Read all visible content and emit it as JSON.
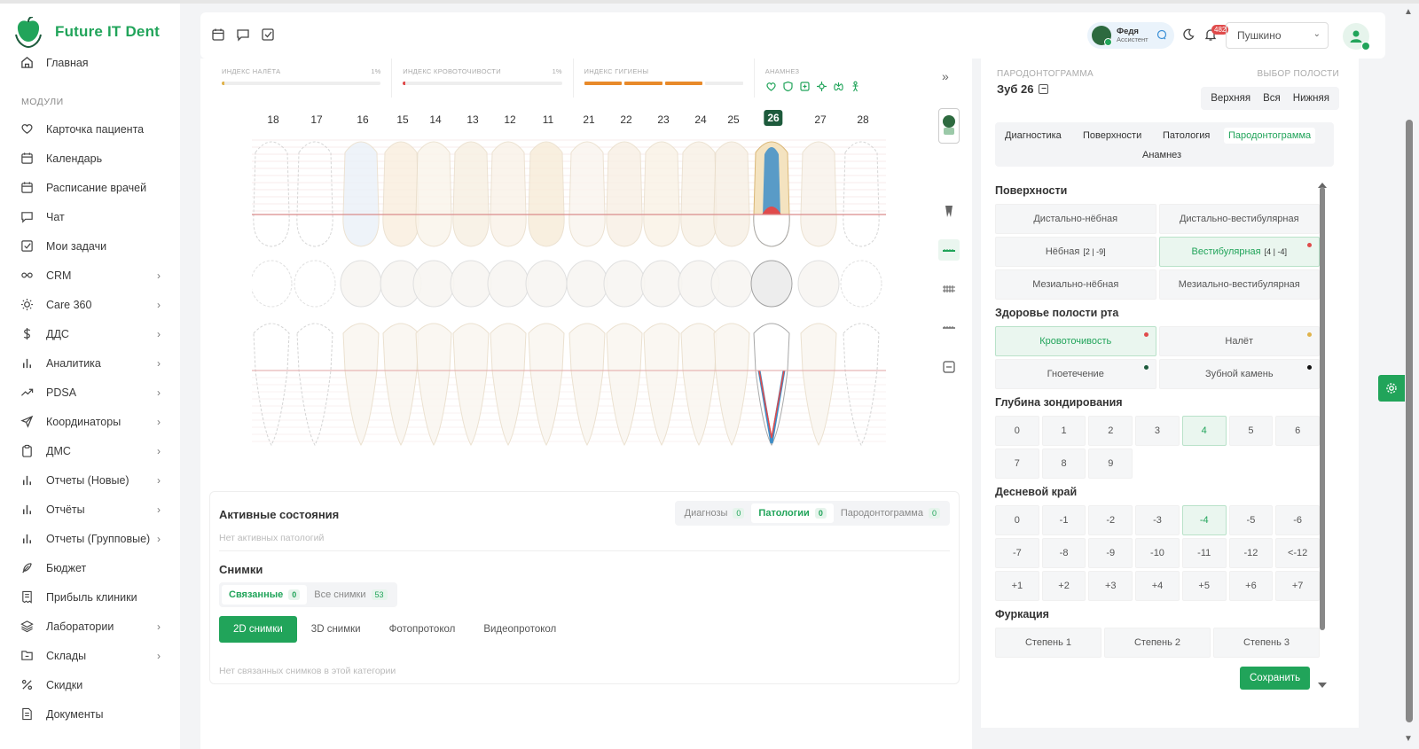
{
  "app": {
    "name": "Future IT Dent"
  },
  "sidebar": {
    "home": "Главная",
    "section_label": "МОДУЛИ",
    "items": [
      {
        "label": "Карточка пациента",
        "icon": "heart-icon",
        "chev": false
      },
      {
        "label": "Календарь",
        "icon": "calendar-icon",
        "chev": false
      },
      {
        "label": "Расписание врачей",
        "icon": "calendar-icon",
        "chev": false
      },
      {
        "label": "Чат",
        "icon": "chat-icon",
        "chev": false
      },
      {
        "label": "Мои задачи",
        "icon": "checkbox-icon",
        "chev": false
      },
      {
        "label": "CRM",
        "icon": "crm-icon",
        "chev": true
      },
      {
        "label": "Care 360",
        "icon": "sun-icon",
        "chev": true
      },
      {
        "label": "ДДС",
        "icon": "dollar-icon",
        "chev": true
      },
      {
        "label": "Аналитика",
        "icon": "bar-chart-icon",
        "chev": true
      },
      {
        "label": "PDSA",
        "icon": "trend-icon",
        "chev": true
      },
      {
        "label": "Координаторы",
        "icon": "send-icon",
        "chev": true
      },
      {
        "label": "ДМС",
        "icon": "clipboard-icon",
        "chev": true
      },
      {
        "label": "Отчеты (Новые)",
        "icon": "bar-chart-icon",
        "chev": true
      },
      {
        "label": "Отчёты",
        "icon": "bar-chart-icon",
        "chev": true
      },
      {
        "label": "Отчеты (Групповые)",
        "icon": "bar-chart-icon",
        "chev": true
      },
      {
        "label": "Бюджет",
        "icon": "feather-icon",
        "chev": false
      },
      {
        "label": "Прибыль клиники",
        "icon": "receipt-icon",
        "chev": false
      },
      {
        "label": "Лаборатории",
        "icon": "layers-icon",
        "chev": true
      },
      {
        "label": "Склады",
        "icon": "folder-icon",
        "chev": true
      },
      {
        "label": "Скидки",
        "icon": "percent-icon",
        "chev": false
      },
      {
        "label": "Документы",
        "icon": "document-icon",
        "chev": false
      }
    ]
  },
  "header": {
    "user_name": "Федя",
    "user_role": "Ассистент",
    "notifications": "482",
    "branch": "Пушкино"
  },
  "indices": [
    {
      "label": "ИНДЕКС НАЛЁТА",
      "pct": "1%",
      "value": 0.01
    },
    {
      "label": "ИНДЕКС КРОВОТОЧИВОСТИ",
      "pct": "1%",
      "value": 0.01
    },
    {
      "label": "ИНДЕКС ГИГИЕНЫ",
      "pct": "",
      "value": 0.75
    },
    {
      "label": "АНАМНЕЗ",
      "pct": "",
      "value": 0
    }
  ],
  "teeth_upper": [
    "18",
    "17",
    "16",
    "15",
    "14",
    "13",
    "12",
    "11",
    "21",
    "22",
    "23",
    "24",
    "25",
    "26",
    "27",
    "28"
  ],
  "selected_tooth": "26",
  "states": {
    "title": "Активные состояния",
    "tabs": [
      {
        "label": "Диагнозы",
        "count": "0"
      },
      {
        "label": "Патологии",
        "count": "0"
      },
      {
        "label": "Пародонтограмма",
        "count": "0"
      }
    ],
    "empty": "Нет активных патологий",
    "shots_title": "Снимки",
    "shots_tabs": [
      {
        "label": "Связанные",
        "count": "0"
      },
      {
        "label": "Все снимки",
        "count": "53"
      }
    ],
    "shot_types": [
      "2D снимки",
      "3D снимки",
      "Фотопротокол",
      "Видеопротокол"
    ],
    "shots_empty": "Нет связанных снимков в этой категории"
  },
  "right": {
    "perio_label": "ПАРОДОНТОГРАММА",
    "polos_label": "ВЫБОР ПОЛОСТИ",
    "tooth_title": "Зуб 26",
    "jaw_tabs": [
      "Верхняя",
      "Вся",
      "Нижняя"
    ],
    "main_tabs": [
      "Диагностика",
      "Поверхности",
      "Патология",
      "Пародонтограмма",
      "Анамнез"
    ],
    "surfaces_title": "Поверхности",
    "surfaces": [
      {
        "label": "Дистально-нёбная",
        "meta": ""
      },
      {
        "label": "Дистально-вестибулярная",
        "meta": ""
      },
      {
        "label": "Нёбная",
        "meta": "[2 | -9]"
      },
      {
        "label": "Вестибулярная",
        "meta": "[4 | -4]"
      },
      {
        "label": "Мезиально-нёбная",
        "meta": ""
      },
      {
        "label": "Мезиально-вестибулярная",
        "meta": ""
      }
    ],
    "health_title": "Здоровье полости рта",
    "health": [
      "Кровоточивость",
      "Налёт",
      "Гноетечение",
      "Зубной камень"
    ],
    "colors": {
      "accent": "#21a45a",
      "bleeding": "#e04b4b",
      "plaque": "#e0b34b",
      "pus": "#1d5a3c",
      "calculus": "#111111"
    },
    "depth_title": "Глубина зондирования",
    "depth": [
      "0",
      "1",
      "2",
      "3",
      "4",
      "5",
      "6",
      "7",
      "8",
      "9"
    ],
    "margin_title": "Десневой край",
    "margin": [
      "0",
      "-1",
      "-2",
      "-3",
      "-4",
      "-5",
      "-6",
      "-7",
      "-8",
      "-9",
      "-10",
      "-11",
      "-12",
      "<-12",
      "+1",
      "+2",
      "+3",
      "+4",
      "+5",
      "+6",
      "+7"
    ],
    "furcation_title": "Фуркация",
    "furcation": [
      "Степень 1",
      "Степень 2",
      "Степень 3"
    ],
    "save": "Сохранить"
  }
}
